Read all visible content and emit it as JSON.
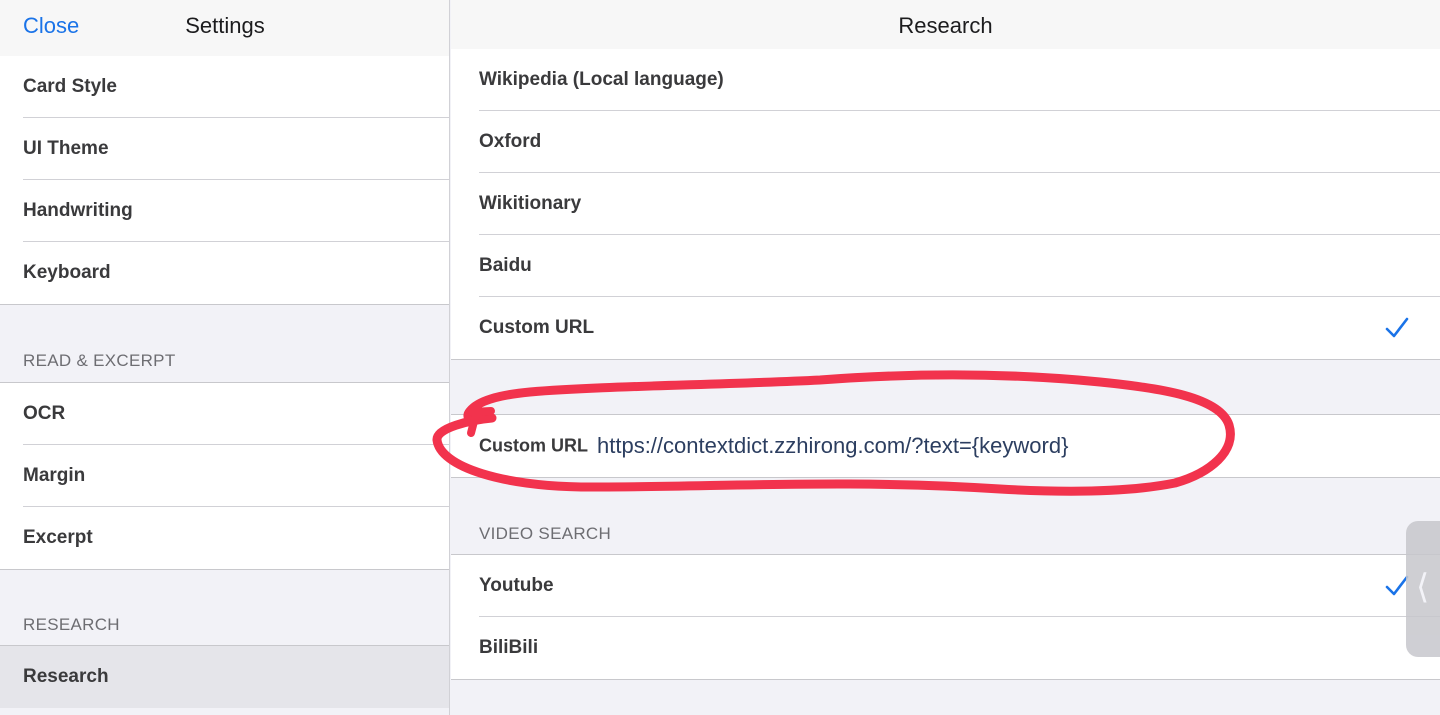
{
  "left_nav": {
    "close_label": "Close",
    "title": "Settings"
  },
  "left_items_top": [
    "Card Style",
    "UI Theme",
    "Handwriting",
    "Keyboard"
  ],
  "read_excerpt": {
    "header": "READ & EXCERPT",
    "items": [
      "OCR",
      "Margin",
      "Excerpt"
    ]
  },
  "research_section": {
    "header": "RESEARCH",
    "items": [
      "Research"
    ]
  },
  "right_nav": {
    "title": "Research"
  },
  "dictionaries": {
    "items": [
      {
        "label": "Wikipedia (Local language)",
        "checked": false
      },
      {
        "label": "Oxford",
        "checked": false
      },
      {
        "label": "Wikitionary",
        "checked": false
      },
      {
        "label": "Baidu",
        "checked": false
      },
      {
        "label": "Custom URL",
        "checked": true
      }
    ]
  },
  "custom_url": {
    "label": "Custom URL",
    "value": "https://contextdict.zzhirong.com/?text={keyword}"
  },
  "video_search": {
    "header": "VIDEO SEARCH",
    "items": [
      {
        "label": "Youtube",
        "checked": true
      },
      {
        "label": "BiliBili",
        "checked": false
      }
    ]
  },
  "colors": {
    "accent": "#1a73e8",
    "annotation": "#f2334d"
  },
  "icons": {
    "check": "checkmark-icon",
    "side_tab": "chevron-left-icon"
  }
}
